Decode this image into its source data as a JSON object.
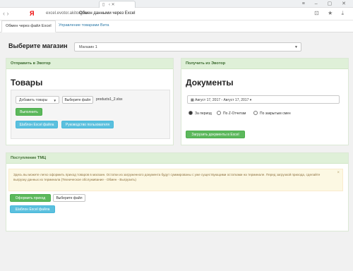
{
  "browser": {
    "url": "excel.evotor.akitorg.ru",
    "page_title": "Обмен данными через Excel"
  },
  "tabs": [
    {
      "label": "Обмен через файл Excel"
    },
    {
      "label": "Управление товарами Вита"
    }
  ],
  "store": {
    "title": "Выберите магазин",
    "selected": "Магазин 1"
  },
  "send_panel": {
    "header": "Отправить в Эвотор",
    "title": "Товары",
    "action_select": "Добавить товары",
    "choose_file_label": "Выберите файл",
    "file_name": "products1_2.xlsx",
    "execute_label": "Выполнить",
    "template_label": "Шаблон Excel файла",
    "guide_label": "Руководство пользователя"
  },
  "receive_panel": {
    "header": "Получить из Эвотор",
    "title": "Документы",
    "date_range": "Август 17, 2017 - Август 17, 2017",
    "radio_options": [
      {
        "label": "За период",
        "selected": true
      },
      {
        "label": "По Z-Отчетам",
        "selected": false
      },
      {
        "label": "По закрытым смен",
        "selected": false
      }
    ],
    "download_label": "Загрузить документы в Excel"
  },
  "receipt_panel": {
    "header": "Поступление ТМЦ",
    "info_text": "Здесь вы можете легко оформить приход товаров в магазин. Остатки из загруженного документа будут суммированы с уже существующими остатками на терминале. Перед загрузкой прихода, сделайте выгрузку данных из терминала (Техническое обслуживание - Обмен - Выгрузить)",
    "submit_label": "Оформить приход",
    "choose_file_label": "Выберите файл",
    "template_label": "Шаблон Excel файла"
  }
}
